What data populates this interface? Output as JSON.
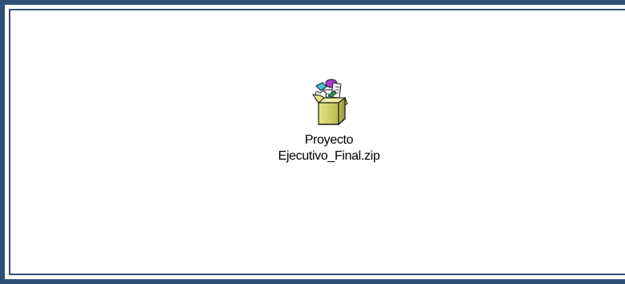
{
  "file": {
    "name": "Proyecto\nEjecutivo_Final.zip",
    "icon": "zip-archive-icon"
  },
  "colors": {
    "frame": "#2f4f77",
    "background": "#ffffff",
    "box_face": "#d7d76f",
    "box_dark": "#9b9b31"
  }
}
